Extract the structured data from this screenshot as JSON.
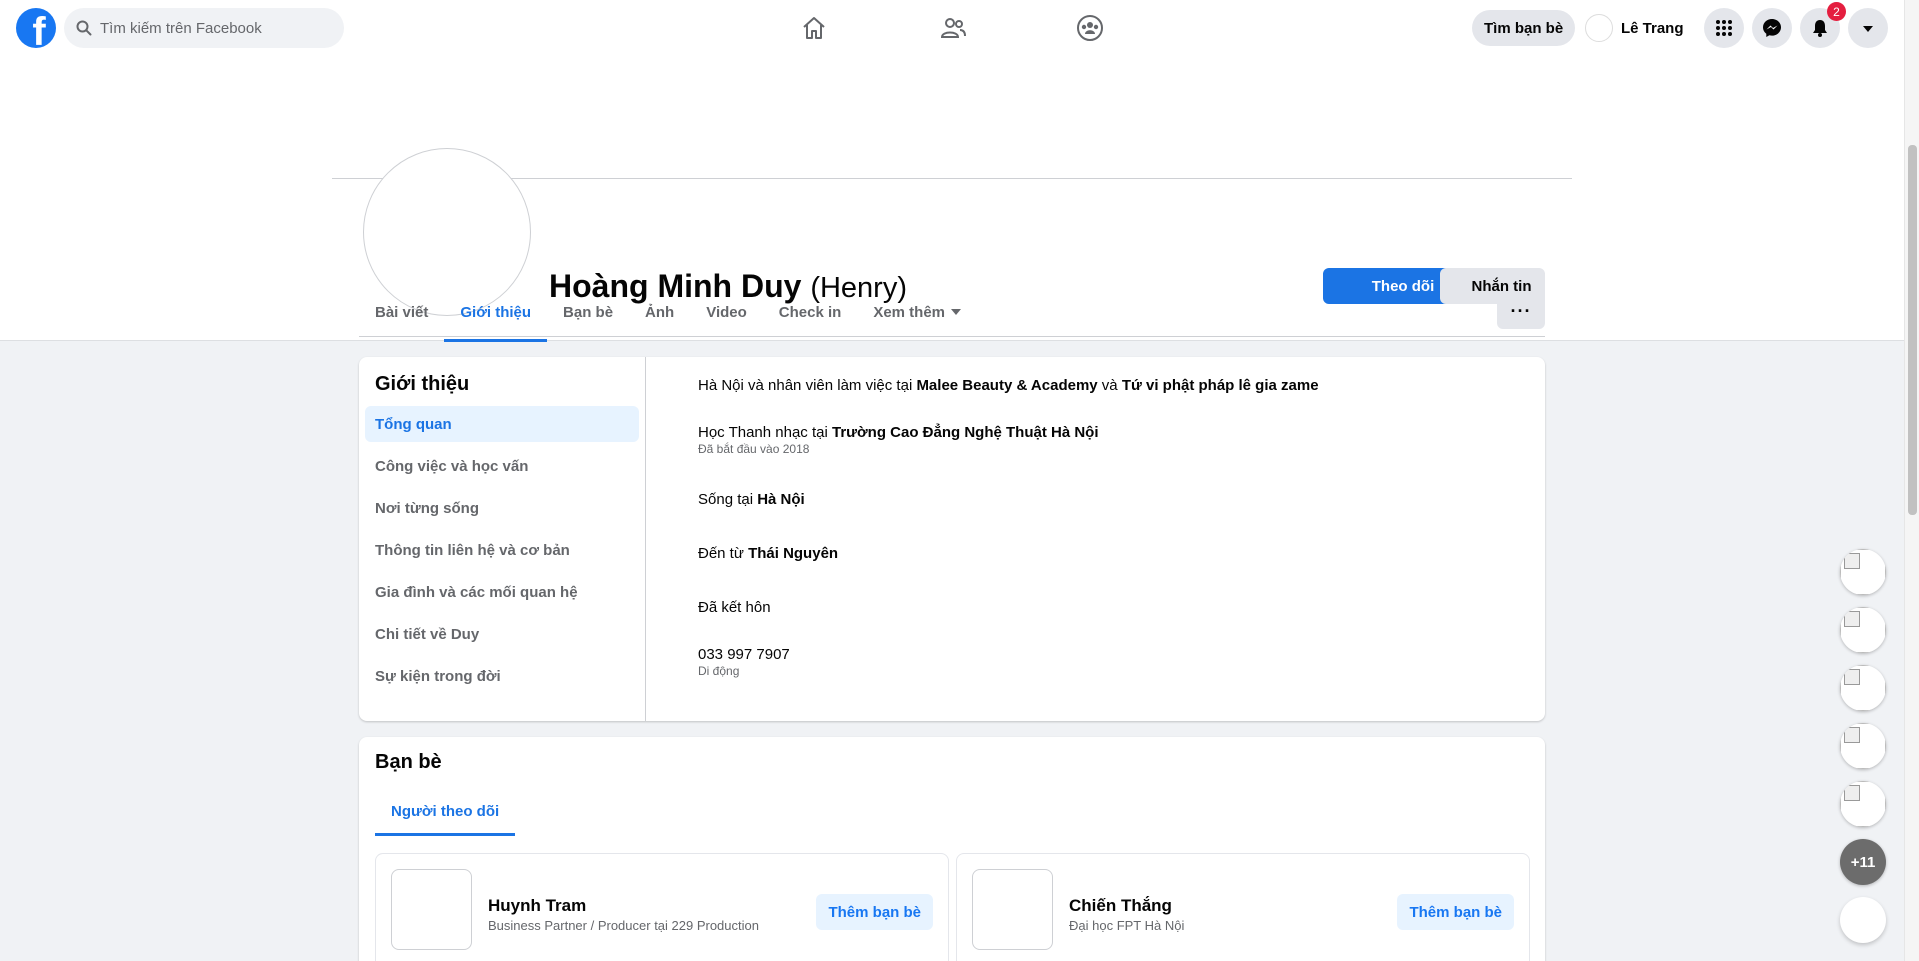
{
  "topbar": {
    "search_placeholder": "Tìm kiếm trên Facebook",
    "logo_letter": "f",
    "find_friends": "Tìm bạn bè",
    "user_name": "Lê Trang",
    "notification_count": "2",
    "nav_icons": [
      "home-icon",
      "friends-icon",
      "groups-icon"
    ],
    "right_icons": [
      "menu-grid-icon",
      "messenger-icon",
      "bell-icon",
      "caret-down-icon"
    ]
  },
  "profile": {
    "name": "Hoàng Minh Duy",
    "alt_name": "(Henry)",
    "follow_label": "Theo dõi",
    "message_label": "Nhắn tin",
    "tabs": [
      "Bài viết",
      "Giới thiệu",
      "Bạn bè",
      "Ảnh",
      "Video",
      "Check in",
      "Xem thêm"
    ],
    "more_label": "···"
  },
  "about": {
    "title": "Giới thiệu",
    "menu": [
      "Tổng quan",
      "Công việc và học vấn",
      "Nơi từng sống",
      "Thông tin liên hệ và cơ bản",
      "Gia đình và các mối quan hệ",
      "Chi tiết về Duy",
      "Sự kiện trong đời"
    ],
    "work": {
      "prefix": "Hà Nội và nhân viên làm việc tại ",
      "place1": "Malee Beauty & Academy",
      "and": " và ",
      "place2": "Tứ vi phật pháp lê gia zame"
    },
    "study": {
      "prefix": "Học Thanh nhạc tại ",
      "school": "Trường Cao Đẳng Nghệ Thuật Hà Nội",
      "sub": "Đã bắt đầu vào 2018"
    },
    "lives": {
      "prefix": "Sống tại ",
      "place": "Hà Nội"
    },
    "from": {
      "prefix": "Đến từ ",
      "place": "Thái Nguyên"
    },
    "relationship": "Đã kết hôn",
    "phone": {
      "value": "033 997 7907",
      "sub": "Di động"
    }
  },
  "friends": {
    "title": "Bạn bè",
    "tab": "Người theo dõi",
    "items": [
      {
        "name": "Huynh Tram",
        "desc": "Business Partner / Producer tại 229 Production",
        "add": "Thêm bạn bè"
      },
      {
        "name": "Chiến Thắng",
        "desc": "Đại học FPT Hà Nội",
        "add": "Thêm bạn bè"
      }
    ]
  },
  "chat": {
    "more_label": "+11"
  },
  "colors": {
    "accent": "#1b74e4",
    "badge": "#e41e3f",
    "background": "#f0f2f5"
  }
}
